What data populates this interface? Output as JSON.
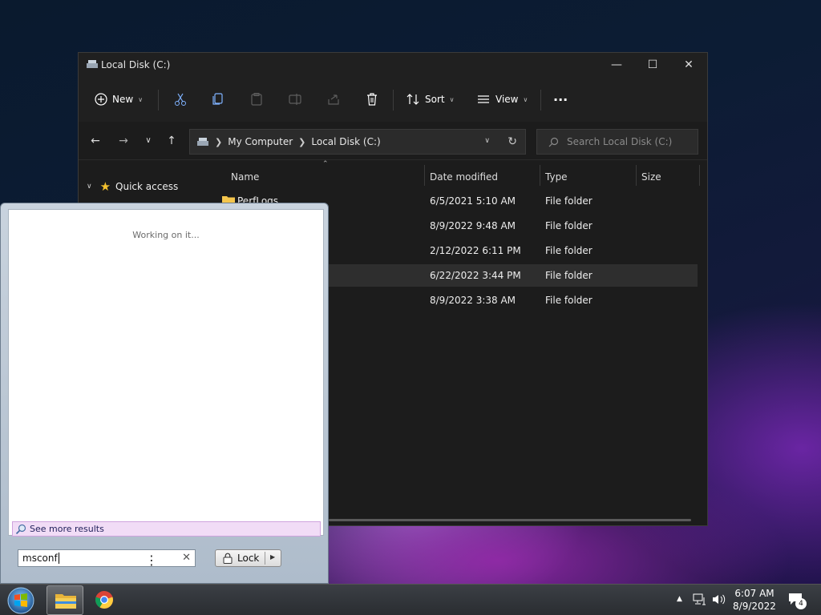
{
  "explorer": {
    "title": "Local Disk (C:)",
    "toolbar": {
      "new_label": "New",
      "sort_label": "Sort",
      "view_label": "View",
      "more_label": "..."
    },
    "breadcrumb": [
      "My Computer",
      "Local Disk (C:)"
    ],
    "search_placeholder": "Search Local Disk (C:)",
    "navpane": {
      "quick_access": "Quick access"
    },
    "columns": {
      "name": "Name",
      "date": "Date modified",
      "type": "Type",
      "size": "Size"
    },
    "rows": [
      {
        "name": "PerfLogs",
        "date": "6/5/2021 5:10 AM",
        "type": "File folder"
      },
      {
        "name": "",
        "date": "8/9/2022 9:48 AM",
        "type": "File folder"
      },
      {
        "name": "",
        "date": "2/12/2022 6:11 PM",
        "type": "File folder"
      },
      {
        "name": "",
        "date": "6/22/2022 3:44 PM",
        "type": "File folder"
      },
      {
        "name": "",
        "date": "8/9/2022 3:38 AM",
        "type": "File folder"
      }
    ],
    "selected_row": 3
  },
  "startmenu": {
    "status": "Working on it...",
    "see_more": "See more results",
    "search_value": "msconf",
    "lock_label": "Lock"
  },
  "taskbar": {
    "time": "6:07 AM",
    "date": "8/9/2022",
    "notification_count": "4"
  },
  "colors": {
    "explorer_bg": "#1c1c1c",
    "selection": "#2e2e2e",
    "see_more_bg": "#f1dcf6",
    "folder": "#f4c54c"
  }
}
